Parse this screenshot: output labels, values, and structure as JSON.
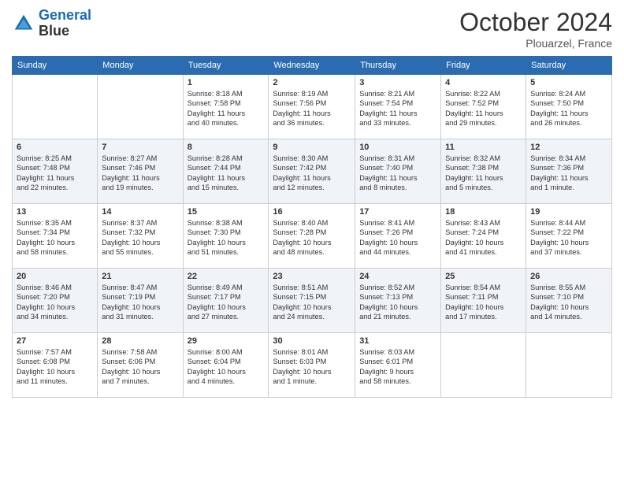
{
  "logo": {
    "line1": "General",
    "line2": "Blue"
  },
  "title": "October 2024",
  "location": "Plouarzel, France",
  "headers": [
    "Sunday",
    "Monday",
    "Tuesday",
    "Wednesday",
    "Thursday",
    "Friday",
    "Saturday"
  ],
  "weeks": [
    [
      {
        "day": "",
        "info": ""
      },
      {
        "day": "",
        "info": ""
      },
      {
        "day": "1",
        "info": "Sunrise: 8:18 AM\nSunset: 7:58 PM\nDaylight: 11 hours\nand 40 minutes."
      },
      {
        "day": "2",
        "info": "Sunrise: 8:19 AM\nSunset: 7:56 PM\nDaylight: 11 hours\nand 36 minutes."
      },
      {
        "day": "3",
        "info": "Sunrise: 8:21 AM\nSunset: 7:54 PM\nDaylight: 11 hours\nand 33 minutes."
      },
      {
        "day": "4",
        "info": "Sunrise: 8:22 AM\nSunset: 7:52 PM\nDaylight: 11 hours\nand 29 minutes."
      },
      {
        "day": "5",
        "info": "Sunrise: 8:24 AM\nSunset: 7:50 PM\nDaylight: 11 hours\nand 26 minutes."
      }
    ],
    [
      {
        "day": "6",
        "info": "Sunrise: 8:25 AM\nSunset: 7:48 PM\nDaylight: 11 hours\nand 22 minutes."
      },
      {
        "day": "7",
        "info": "Sunrise: 8:27 AM\nSunset: 7:46 PM\nDaylight: 11 hours\nand 19 minutes."
      },
      {
        "day": "8",
        "info": "Sunrise: 8:28 AM\nSunset: 7:44 PM\nDaylight: 11 hours\nand 15 minutes."
      },
      {
        "day": "9",
        "info": "Sunrise: 8:30 AM\nSunset: 7:42 PM\nDaylight: 11 hours\nand 12 minutes."
      },
      {
        "day": "10",
        "info": "Sunrise: 8:31 AM\nSunset: 7:40 PM\nDaylight: 11 hours\nand 8 minutes."
      },
      {
        "day": "11",
        "info": "Sunrise: 8:32 AM\nSunset: 7:38 PM\nDaylight: 11 hours\nand 5 minutes."
      },
      {
        "day": "12",
        "info": "Sunrise: 8:34 AM\nSunset: 7:36 PM\nDaylight: 11 hours\nand 1 minute."
      }
    ],
    [
      {
        "day": "13",
        "info": "Sunrise: 8:35 AM\nSunset: 7:34 PM\nDaylight: 10 hours\nand 58 minutes."
      },
      {
        "day": "14",
        "info": "Sunrise: 8:37 AM\nSunset: 7:32 PM\nDaylight: 10 hours\nand 55 minutes."
      },
      {
        "day": "15",
        "info": "Sunrise: 8:38 AM\nSunset: 7:30 PM\nDaylight: 10 hours\nand 51 minutes."
      },
      {
        "day": "16",
        "info": "Sunrise: 8:40 AM\nSunset: 7:28 PM\nDaylight: 10 hours\nand 48 minutes."
      },
      {
        "day": "17",
        "info": "Sunrise: 8:41 AM\nSunset: 7:26 PM\nDaylight: 10 hours\nand 44 minutes."
      },
      {
        "day": "18",
        "info": "Sunrise: 8:43 AM\nSunset: 7:24 PM\nDaylight: 10 hours\nand 41 minutes."
      },
      {
        "day": "19",
        "info": "Sunrise: 8:44 AM\nSunset: 7:22 PM\nDaylight: 10 hours\nand 37 minutes."
      }
    ],
    [
      {
        "day": "20",
        "info": "Sunrise: 8:46 AM\nSunset: 7:20 PM\nDaylight: 10 hours\nand 34 minutes."
      },
      {
        "day": "21",
        "info": "Sunrise: 8:47 AM\nSunset: 7:19 PM\nDaylight: 10 hours\nand 31 minutes."
      },
      {
        "day": "22",
        "info": "Sunrise: 8:49 AM\nSunset: 7:17 PM\nDaylight: 10 hours\nand 27 minutes."
      },
      {
        "day": "23",
        "info": "Sunrise: 8:51 AM\nSunset: 7:15 PM\nDaylight: 10 hours\nand 24 minutes."
      },
      {
        "day": "24",
        "info": "Sunrise: 8:52 AM\nSunset: 7:13 PM\nDaylight: 10 hours\nand 21 minutes."
      },
      {
        "day": "25",
        "info": "Sunrise: 8:54 AM\nSunset: 7:11 PM\nDaylight: 10 hours\nand 17 minutes."
      },
      {
        "day": "26",
        "info": "Sunrise: 8:55 AM\nSunset: 7:10 PM\nDaylight: 10 hours\nand 14 minutes."
      }
    ],
    [
      {
        "day": "27",
        "info": "Sunrise: 7:57 AM\nSunset: 6:08 PM\nDaylight: 10 hours\nand 11 minutes."
      },
      {
        "day": "28",
        "info": "Sunrise: 7:58 AM\nSunset: 6:06 PM\nDaylight: 10 hours\nand 7 minutes."
      },
      {
        "day": "29",
        "info": "Sunrise: 8:00 AM\nSunset: 6:04 PM\nDaylight: 10 hours\nand 4 minutes."
      },
      {
        "day": "30",
        "info": "Sunrise: 8:01 AM\nSunset: 6:03 PM\nDaylight: 10 hours\nand 1 minute."
      },
      {
        "day": "31",
        "info": "Sunrise: 8:03 AM\nSunset: 6:01 PM\nDaylight: 9 hours\nand 58 minutes."
      },
      {
        "day": "",
        "info": ""
      },
      {
        "day": "",
        "info": ""
      }
    ]
  ]
}
